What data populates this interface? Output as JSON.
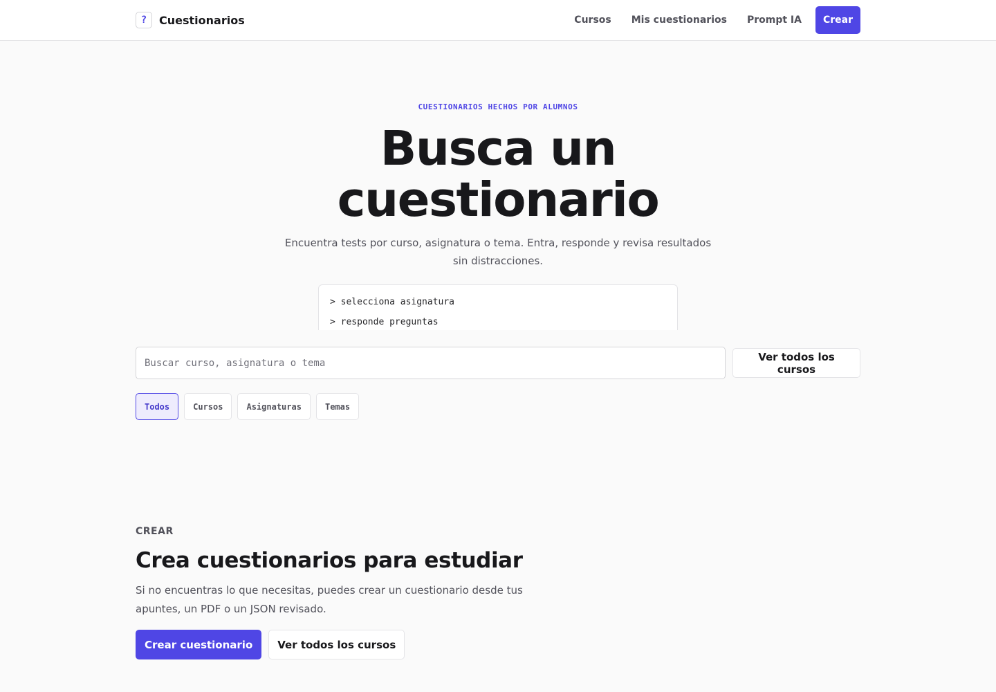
{
  "brand": {
    "icon_glyph": "?",
    "icon": "question-mark-icon",
    "name": "Cuestionarios"
  },
  "nav": {
    "links": [
      "Cursos",
      "Mis cuestionarios",
      "Prompt IA"
    ],
    "create_label": "Crear"
  },
  "hero": {
    "eyebrow": "CUESTIONARIOS HECHOS POR ALUMNOS",
    "title_line1": "Busca un",
    "title_line2": "cuestionario",
    "subtitle": "Encuentra tests por curso, asignatura o tema. Entra, responde y revisa resultados sin distracciones.",
    "terminal_lines": [
      "> selecciona asignatura",
      "> responde preguntas"
    ]
  },
  "search": {
    "placeholder": "Buscar curso, asignatura o tema",
    "value": "",
    "all_courses_label": "Ver todos los cursos"
  },
  "filters": [
    {
      "label": "Todos",
      "active": true
    },
    {
      "label": "Cursos",
      "active": false
    },
    {
      "label": "Asignaturas",
      "active": false
    },
    {
      "label": "Temas",
      "active": false
    }
  ],
  "create_section": {
    "label": "CREAR",
    "title": "Crea cuestionarios para estudiar",
    "text": "Si no encuentras lo que necesitas, puedes crear un cuestionario desde tus apuntes, un PDF o un JSON revisado.",
    "primary_label": "Crear cuestionario",
    "secondary_label": "Ver todos los cursos"
  },
  "colors": {
    "accent": "#4f46e5",
    "background": "#fafafa",
    "text": "#18181b",
    "muted": "#52525b"
  }
}
